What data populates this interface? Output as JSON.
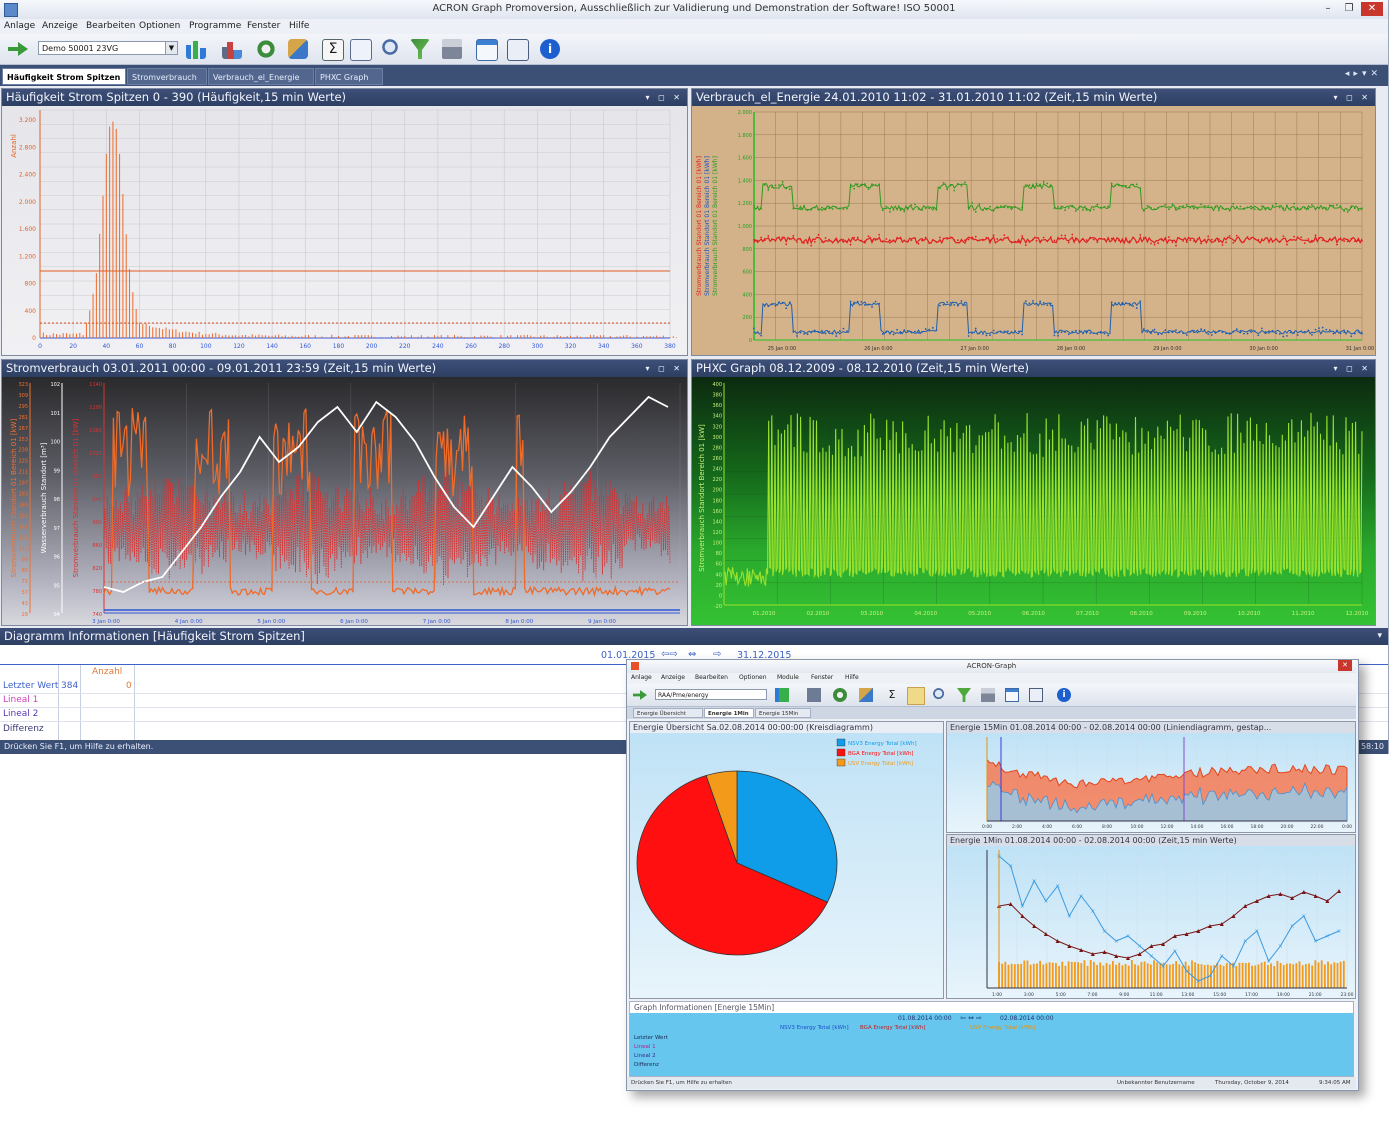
{
  "window": {
    "title": "ACRON Graph Promoversion, Ausschließlich zur Validierung und Demonstration der Software! ISO 50001",
    "controls": {
      "minimize": "–",
      "restore": "❐",
      "close": "✕"
    }
  },
  "menu": [
    "Anlage",
    "Anzeige",
    "Bearbeiten",
    "Optionen",
    "Programme",
    "Fenster",
    "Hilfe"
  ],
  "toolbar": {
    "combo_value": "Demo 50001 23VG",
    "icons": [
      "exit-icon",
      "chart-add-icon",
      "chart-icon",
      "refresh-icon",
      "export-icon",
      "sum-icon",
      "report-icon",
      "zoom-icon",
      "filter-icon",
      "print-icon",
      "window-icon",
      "settings-icon",
      "info-icon"
    ]
  },
  "tabs": [
    "Häufigkeit Strom Spitzen",
    "Stromverbrauch",
    "Verbrauch_el_Energie",
    "PHXC Graph"
  ],
  "panels": {
    "freq": {
      "title": "Häufigkeit Strom Spitzen 0 - 390 (Häufigkeit,15 min Werte)",
      "ylabel": "Anzahl",
      "yticks": [
        "3.200",
        "2.800",
        "2.400",
        "2.000",
        "1.600",
        "1.200",
        "800",
        "400",
        "0"
      ],
      "xticks": [
        "0",
        "20",
        "40",
        "60",
        "80",
        "100",
        "120",
        "140",
        "160",
        "180",
        "200",
        "220",
        "240",
        "260",
        "280",
        "300",
        "320",
        "340",
        "360",
        "380"
      ]
    },
    "energy": {
      "title": "Verbrauch_el_Energie 24.01.2010 11:02 - 31.01.2010 11:02 (Zeit,15 min Werte)",
      "xticks": [
        "25 Jan 0:00",
        "26 Jan 0:00",
        "27 Jan 0:00",
        "28 Jan 0:00",
        "29 Jan 0:00",
        "30 Jan 0:00",
        "31 Jan 0:00"
      ],
      "yticks": [
        "2.000",
        "1.800",
        "1.600",
        "1.400",
        "1.200",
        "1.000",
        "800",
        "600",
        "400",
        "200",
        "0"
      ]
    },
    "strom": {
      "title": "Stromverbrauch 03.01.2011 00:00 - 09.01.2011 23:59 (Zeit,15 min Werte)",
      "xticks": [
        "3 Jan 0:00",
        "4 Jan 0:00",
        "5 Jan 0:00",
        "6 Jan 0:00",
        "7 Jan 0:00",
        "8 Jan 0:00",
        "9 Jan 0:00"
      ]
    },
    "phxc": {
      "title": "PHXC Graph 08.12.2009 - 08.12.2010 (Zeit,15 min Werte)",
      "ylabel": "Stromverbrauch Standort Bereich 01 [kW]",
      "xticks": [
        "01.2010",
        "02.2010",
        "03.2010",
        "04.2010",
        "05.2010",
        "06.2010",
        "07.2010",
        "08.2010",
        "09.2010",
        "10.2010",
        "11.2010",
        "12.2010"
      ]
    }
  },
  "info": {
    "title": "Diagramm Informationen [Häufigkeit Strom Spitzen]",
    "date_from": "01.01.2015",
    "date_to": "31.12.2015",
    "column": "Anzahl",
    "rows": [
      {
        "label": "Letzter Wert",
        "c1": "384",
        "c2": "0"
      },
      {
        "label": "Lineal 1",
        "c1": "",
        "c2": ""
      },
      {
        "label": "Lineal 2",
        "c1": "",
        "c2": ""
      },
      {
        "label": "Differenz",
        "c1": "",
        "c2": ""
      }
    ]
  },
  "status": {
    "hint": "Drücken Sie F1, um Hilfe zu erhalten.",
    "right": "58:10"
  },
  "window2": {
    "title": "ACRON-Graph",
    "menu": [
      "Anlage",
      "Anzeige",
      "Bearbeiten",
      "Optionen",
      "Module",
      "Fenster",
      "Hilfe"
    ],
    "combo_value": "RAA/Pme/energy",
    "tabs": [
      "Energie Übersicht",
      "Energie 1Min",
      "Energie 15Min"
    ],
    "pie": {
      "title": "Energie Übersicht Sa.02.08.2014 00:00:00 (Kreisdiagramm)",
      "legend": [
        "NSV3 Energy Total [kWh]",
        "BGA Energy Total [kWh]",
        "USV Energy Total [kWh]"
      ]
    },
    "line15": {
      "title": "Energie 15Min 01.08.2014 00:00 - 02.08.2014 00:00 (Liniendiagramm, gestap..."
    },
    "line1": {
      "title": "Energie 1Min 01.08.2014 00:00 - 02.08.2014 00:00 (Zeit,15 min Werte)"
    },
    "info": {
      "title": "Graph Informationen [Energie 15Min]",
      "date_from": "01.08.2014 00:00",
      "date_to": "02.08.2014 00:00",
      "columns": [
        "NSV3 Energy Total [kWh]",
        "BGA Energy Total [kWh]",
        "USV Energy Total [kWh]"
      ],
      "rows": [
        "Letzter Wert",
        "Lineal 1",
        "Lineal 2",
        "Differenz"
      ]
    },
    "status": {
      "left": "Drücken Sie F1, um Hilfe zu erhalten",
      "mid": "Unbekannter Benutzername",
      "right": "Thursday, October 9, 2014",
      "time": "9:34:05 AM"
    }
  },
  "colors": {
    "panel_header": "#2e3f63",
    "freq_bars": "#ee6a2a",
    "energy_bg": "#d3b289",
    "energy_green": "#2f9a1f",
    "energy_red": "#e02020",
    "energy_blue": "#1f5fae",
    "phxc_bars": "#9be22d",
    "pie_blue": "#0f9ce8",
    "pie_red": "#ff0f0f",
    "pie_orange": "#f39a1a"
  }
}
